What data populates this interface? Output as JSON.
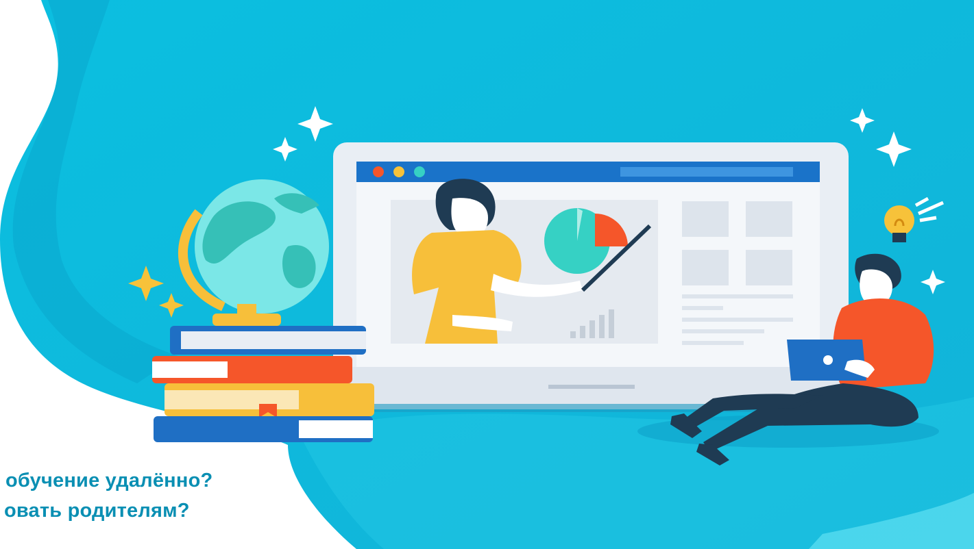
{
  "headline": {
    "line1": "обучение удалённо?",
    "line2": "овать родителям?"
  },
  "colors": {
    "background": "#ffffff",
    "blob_light": "#1ec5e3",
    "blob_dark": "#00b5d9",
    "headline_text": "#0a8fb3",
    "browser_bar": "#1a73c9",
    "teacher_shirt": "#f7bf3a",
    "student_sweater": "#f5562a",
    "pie_teal": "#36d1c4",
    "pie_red": "#f5562a"
  },
  "icons": [
    "globe-icon",
    "book-stack-icon",
    "laptop-icon",
    "lightbulb-icon",
    "sparkle-icon",
    "pie-chart-icon",
    "bar-chart-icon"
  ]
}
